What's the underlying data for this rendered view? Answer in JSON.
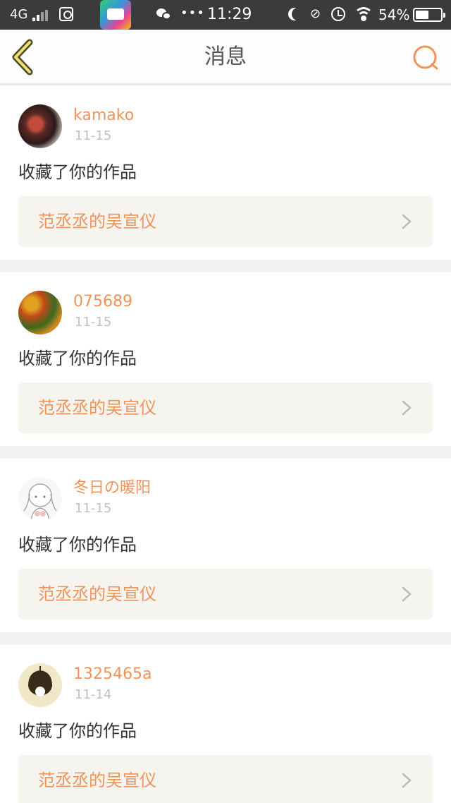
{
  "status_bar": {
    "carrier": "4G",
    "time": "11:29",
    "dots": "•••",
    "battery_percent": "54%",
    "battery_level": 0.54,
    "icons": [
      "signal-icon",
      "mail-icon",
      "app-icon",
      "wechat-icon",
      "moon-icon",
      "mute-icon",
      "alarm-icon",
      "wifi-icon",
      "battery-icon"
    ]
  },
  "nav": {
    "title": "消息",
    "back_icon": "chevron-left-icon",
    "search_icon": "search-icon",
    "accent_color": "#f0935a"
  },
  "messages": [
    {
      "user": "kamako",
      "date": "11-15",
      "action": "收藏了你的作品",
      "work": "范丞丞的吴宣仪"
    },
    {
      "user": "075689",
      "date": "11-15",
      "action": "收藏了你的作品",
      "work": "范丞丞的吴宣仪"
    },
    {
      "user": "冬日の暖阳",
      "date": "11-15",
      "action": "收藏了你的作品",
      "work": "范丞丞的吴宣仪"
    },
    {
      "user": "1325465a",
      "date": "11-14",
      "action": "收藏了你的作品",
      "work": "范丞丞的吴宣仪"
    }
  ]
}
